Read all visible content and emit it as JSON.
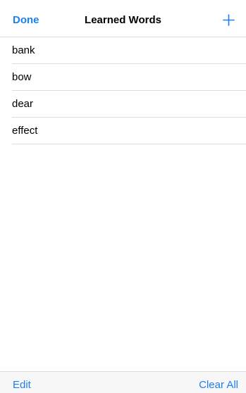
{
  "nav": {
    "done_label": "Done",
    "title": "Learned Words",
    "add_icon": "plus-icon"
  },
  "words": [
    {
      "label": "bank"
    },
    {
      "label": "bow"
    },
    {
      "label": "dear"
    },
    {
      "label": "effect"
    }
  ],
  "toolbar": {
    "edit_label": "Edit",
    "clear_label": "Clear All"
  },
  "colors": {
    "accent": "#1b7ff0",
    "separator": "#dcdce0",
    "toolbar_background": "#f7f7f8"
  }
}
